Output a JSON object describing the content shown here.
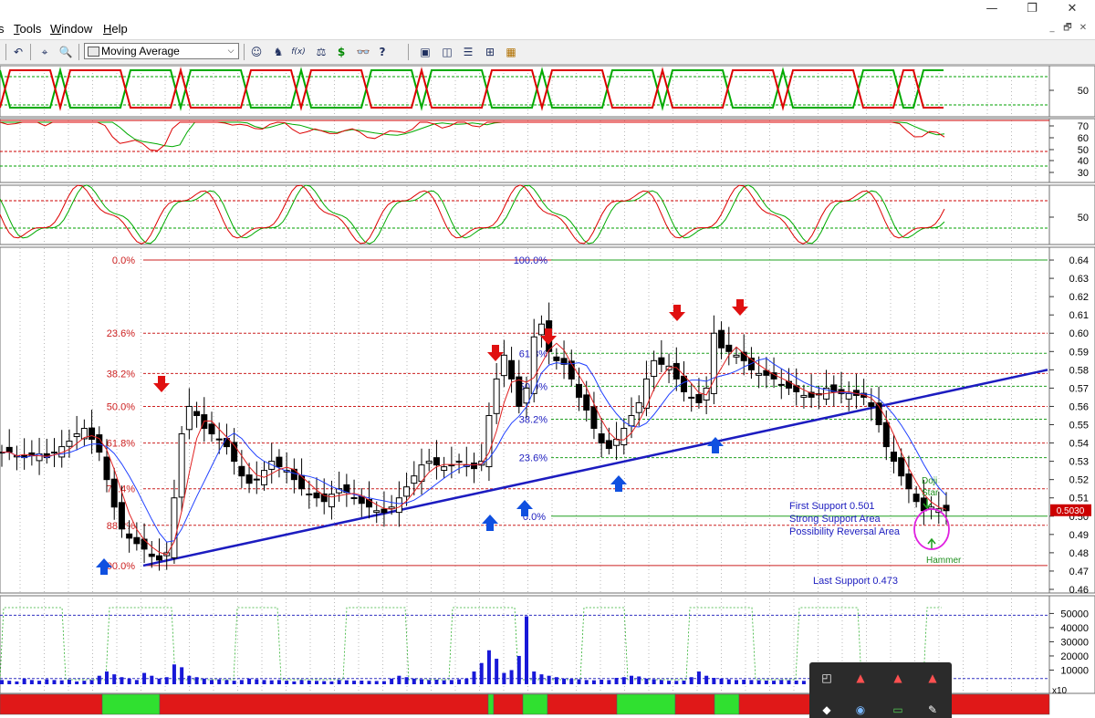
{
  "window": {
    "minimize_icon": "minimize-icon",
    "restore_icon": "restore-icon",
    "close_icon": "close-icon",
    "min_glyph": "—",
    "restore_glyph": "❐",
    "close_glyph": "✕"
  },
  "menu": {
    "items": [
      {
        "cut": "",
        "key": "",
        "rest": "s"
      },
      {
        "cut": "",
        "key": "T",
        "rest": "ools"
      },
      {
        "cut": "",
        "key": "W",
        "rest": "indow"
      },
      {
        "cut": "",
        "key": "H",
        "rest": "elp"
      }
    ],
    "mdi_min": "_",
    "mdi_restore": "🗗",
    "mdi_close": "✕"
  },
  "toolbar": {
    "indicator_selected": "Moving Average",
    "dropdown_glyph": "⌵",
    "buttons": [
      {
        "name": "undo-icon",
        "glyph": "↶"
      },
      {
        "name": "crosshair-icon",
        "glyph": "⌖"
      },
      {
        "name": "zoom-icon",
        "glyph": "🔍"
      },
      {
        "name": "expert-icon",
        "glyph": "☺"
      },
      {
        "name": "wizard-icon",
        "glyph": "♞"
      },
      {
        "name": "formula-icon",
        "glyph": "f(x)"
      },
      {
        "name": "scales-icon",
        "glyph": "⚖"
      },
      {
        "name": "dollar-icon",
        "glyph": "$"
      },
      {
        "name": "binoculars-icon",
        "glyph": "👓"
      },
      {
        "name": "help-pointer-icon",
        "glyph": "?"
      },
      {
        "name": "layout-1-icon",
        "glyph": "▣"
      },
      {
        "name": "layout-2-icon",
        "glyph": "◫"
      },
      {
        "name": "layout-3-icon",
        "glyph": "☰"
      },
      {
        "name": "layout-4-icon",
        "glyph": "⊞"
      },
      {
        "name": "layout-5-icon",
        "glyph": "▦"
      }
    ]
  },
  "chart_data": {
    "type": "candlestick",
    "panels": [
      {
        "name": "trend-oscillator",
        "axis_labels": [
          "50"
        ],
        "series_colors": [
          "#dd0000",
          "#00aa00"
        ]
      },
      {
        "name": "rsi",
        "axis_labels": [
          "70",
          "60",
          "50",
          "40",
          "30"
        ],
        "series_colors": [
          "#dd0000",
          "#00aa00"
        ]
      },
      {
        "name": "stochastic",
        "axis_labels": [
          "50"
        ],
        "series_colors": [
          "#dd0000",
          "#00aa00"
        ]
      },
      {
        "name": "price",
        "axis_labels": [
          "0.64",
          "0.63",
          "0.62",
          "0.61",
          "0.60",
          "0.59",
          "0.58",
          "0.57",
          "0.56",
          "0.55",
          "0.54",
          "0.53",
          "0.52",
          "0.51",
          "0.50",
          "0.49",
          "0.48",
          "0.47",
          "0.46"
        ],
        "ylim": [
          0.458,
          0.647
        ],
        "current_price_label": "0.5030",
        "fib_left": {
          "levels": [
            "0.0%",
            "23.6%",
            "38.2%",
            "50.0%",
            "61.8%",
            "76.4%",
            "88.2%",
            "100.0%"
          ],
          "prices": [
            0.64,
            0.6,
            0.578,
            0.56,
            0.54,
            0.515,
            0.495,
            0.473
          ]
        },
        "fib_right_top": {
          "levels": [
            "100.0%",
            "61.8%",
            "50.0%",
            "38.2%",
            "23.6%"
          ],
          "prices": [
            0.64,
            0.589,
            0.571,
            0.553,
            0.532
          ]
        },
        "fib_right_bottom_label": "0.0%",
        "fib_right_bottom_price": 0.5,
        "annotations": {
          "first_support": "First Support 0.501",
          "strong_support": "Strong Support Area",
          "reversal": "Possibility Reversal Area",
          "last_support": "Last Support 0.473",
          "doji_line1": "Doji",
          "doji_line2": "Star",
          "hammer": "Hammer"
        },
        "down_arrows_count": 5,
        "up_arrows_count": 6
      },
      {
        "name": "volume",
        "axis_labels": [
          "50000",
          "40000",
          "30000",
          "20000",
          "10000"
        ],
        "multiplier_label": "x10",
        "ylim": [
          0,
          58000
        ]
      }
    ],
    "price_series_approx": [
      0.535,
      0.535,
      0.533,
      0.532,
      0.533,
      0.534,
      0.532,
      0.535,
      0.538,
      0.541,
      0.545,
      0.548,
      0.542,
      0.535,
      0.52,
      0.505,
      0.493,
      0.488,
      0.485,
      0.482,
      0.478,
      0.476,
      0.48,
      0.51,
      0.545,
      0.56,
      0.555,
      0.548,
      0.545,
      0.542,
      0.538,
      0.53,
      0.522,
      0.518,
      0.52,
      0.525,
      0.53,
      0.527,
      0.525,
      0.52,
      0.515,
      0.512,
      0.51,
      0.508,
      0.512,
      0.515,
      0.513,
      0.51,
      0.507,
      0.505,
      0.503,
      0.502,
      0.505,
      0.51,
      0.516,
      0.522,
      0.528,
      0.53,
      0.528,
      0.527,
      0.528,
      0.53,
      0.528,
      0.526,
      0.53,
      0.555,
      0.575,
      0.588,
      0.575,
      0.56,
      0.57,
      0.598,
      0.605,
      0.59,
      0.585,
      0.583,
      0.575,
      0.565,
      0.558,
      0.548,
      0.54,
      0.537,
      0.542,
      0.548,
      0.555,
      0.562,
      0.575,
      0.585,
      0.583,
      0.582,
      0.575,
      0.568,
      0.565,
      0.562,
      0.57,
      0.6,
      0.592,
      0.59,
      0.588,
      0.585,
      0.58,
      0.578,
      0.577,
      0.575,
      0.572,
      0.57,
      0.568,
      0.566,
      0.565,
      0.567,
      0.57,
      0.568,
      0.567,
      0.567,
      0.566,
      0.565,
      0.56,
      0.55,
      0.538,
      0.53,
      0.522,
      0.515,
      0.508,
      0.503,
      0.505,
      0.504,
      0.503
    ],
    "volume_series_approx": [
      3000,
      2500,
      2000,
      4000,
      3000,
      2500,
      3500,
      3000,
      2800,
      3200,
      2000,
      2500,
      3000,
      6000,
      9000,
      7000,
      5000,
      4000,
      3000,
      8000,
      6000,
      4000,
      5000,
      14000,
      12000,
      6000,
      5000,
      4000,
      3000,
      3500,
      3000,
      2500,
      3000,
      4000,
      3500,
      3000,
      2800,
      3000,
      2500,
      2000,
      3000,
      2600,
      2400,
      2200,
      2000,
      3000,
      2800,
      2500,
      2600,
      2400,
      2300,
      2200,
      4000,
      6000,
      5000,
      4000,
      3500,
      3000,
      3200,
      2800,
      3000,
      3500,
      4000,
      9000,
      15000,
      24000,
      18000,
      8000,
      10000,
      20000,
      48000,
      9000,
      7000,
      6000,
      5000,
      4000,
      3800,
      3500,
      3000,
      2800,
      3200,
      3000,
      4500,
      5000,
      6000,
      5500,
      4000,
      3500,
      3000,
      2500,
      2400,
      2600,
      5000,
      9000,
      6000,
      4500,
      4000,
      3500,
      3000,
      3200,
      3000,
      2800,
      2600,
      2500,
      3000,
      2800,
      2600,
      2400,
      3000,
      2800,
      3500,
      3000,
      2500,
      2600,
      2400,
      3000,
      4000,
      5000,
      3500,
      3000,
      2800,
      3200,
      3500,
      4000,
      3000,
      2500,
      2000
    ],
    "trend_bar_states": [
      "red",
      "green",
      "red",
      "green",
      "red",
      "green",
      "red",
      "green",
      "red",
      "green",
      "red"
    ],
    "trend_bar_splits": [
      0,
      112,
      175,
      535,
      541,
      573,
      600,
      676,
      740,
      783,
      810,
      1150
    ]
  },
  "popup": {
    "buttons": [
      {
        "name": "layout-icon",
        "glyph": "◰"
      },
      {
        "name": "indicator-a-icon",
        "glyph": "▲"
      },
      {
        "name": "indicator-b-icon",
        "glyph": "▲"
      },
      {
        "name": "indicator-c-icon",
        "glyph": "▲"
      },
      {
        "name": "diamond-icon",
        "glyph": "◆"
      },
      {
        "name": "globe-icon",
        "glyph": "◉"
      },
      {
        "name": "screen-icon",
        "glyph": "▭"
      },
      {
        "name": "pen-icon",
        "glyph": "✎"
      }
    ]
  }
}
